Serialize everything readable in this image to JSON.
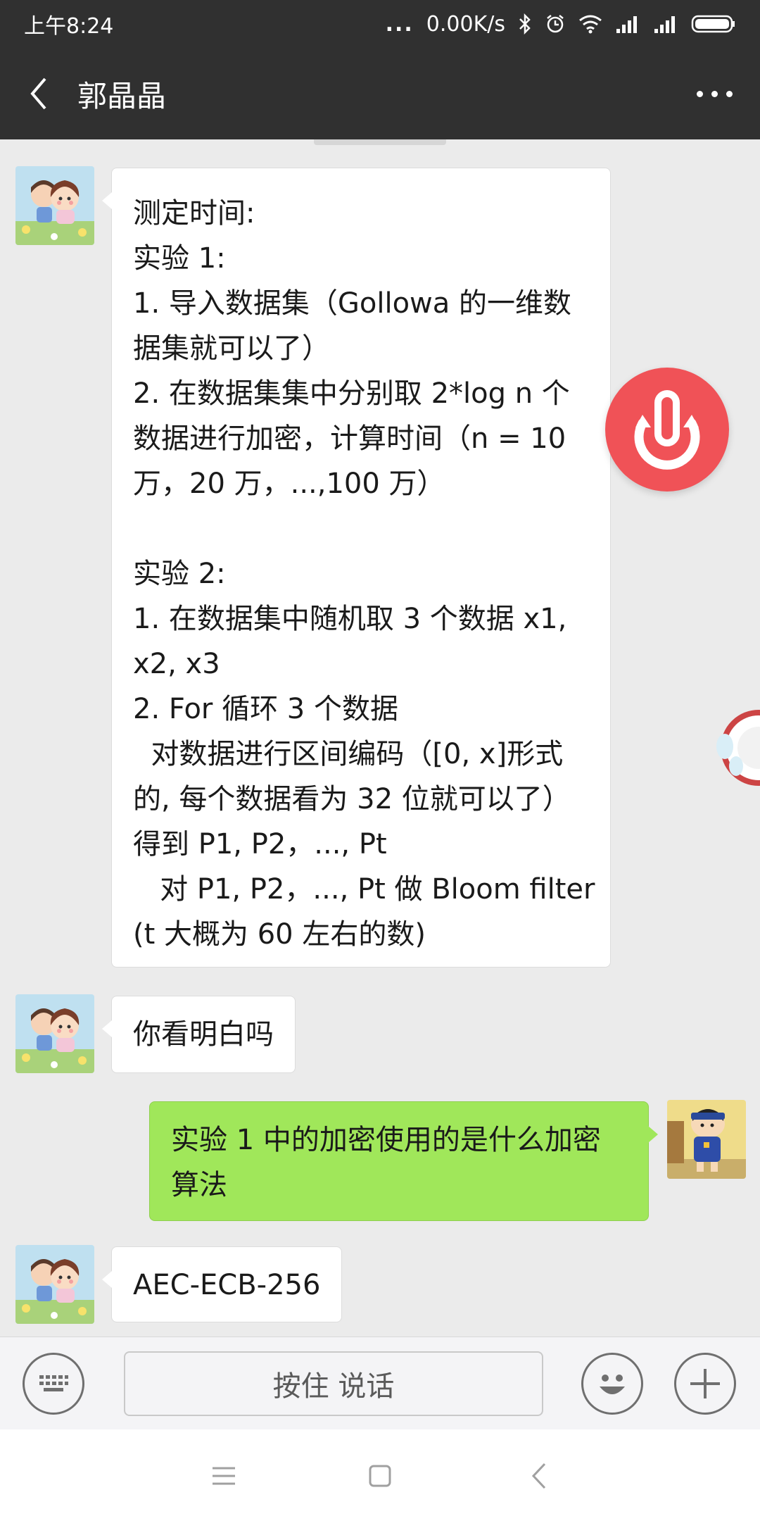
{
  "status_bar": {
    "time": "上午8:24",
    "dots": "...",
    "net_speed": "0.00K/s"
  },
  "nav": {
    "title": "郭晶晶"
  },
  "messages": [
    {
      "direction": "in",
      "lines": [
        "测定时间:",
        "实验 1:",
        "1. 导入数据集（Gollowa 的一维数",
        "据集就可以了）",
        "2. 在数据集集中分别取 2*log n 个",
        "数据进行加密，计算时间（n = 10",
        "万，20 万，...,100 万）",
        "",
        "实验 2:",
        "1. 在数据集中随机取 3 个数据 x1,",
        "x2, x3",
        "2. For 循环 3 个数据",
        "  对数据进行区间编码（[0, x]形式",
        "的, 每个数据看为 32 位就可以了）",
        "得到 P1, P2，..., Pt",
        "   对 P1, P2，..., Pt 做 Bloom filter",
        "(t 大概为 60 左右的数)"
      ]
    },
    {
      "direction": "in",
      "lines": [
        "你看明白吗"
      ]
    },
    {
      "direction": "out",
      "lines": [
        "实验 1 中的加密使用的是什么加密",
        "算法"
      ]
    },
    {
      "direction": "in",
      "lines": [
        "AEC-ECB-256"
      ]
    }
  ],
  "input_bar": {
    "voice_label": "按住 说话"
  },
  "icons": {
    "back": "chevron-left-icon",
    "more": "more-dots-icon",
    "keyboard": "keyboard-icon",
    "emoji": "emoji-icon",
    "add": "plus-icon"
  },
  "colors": {
    "header": "#303030",
    "background": "#ebebeb",
    "bubble_out": "#a0e75a",
    "bubble_in": "#ffffff",
    "float_widget": "#f05257"
  }
}
